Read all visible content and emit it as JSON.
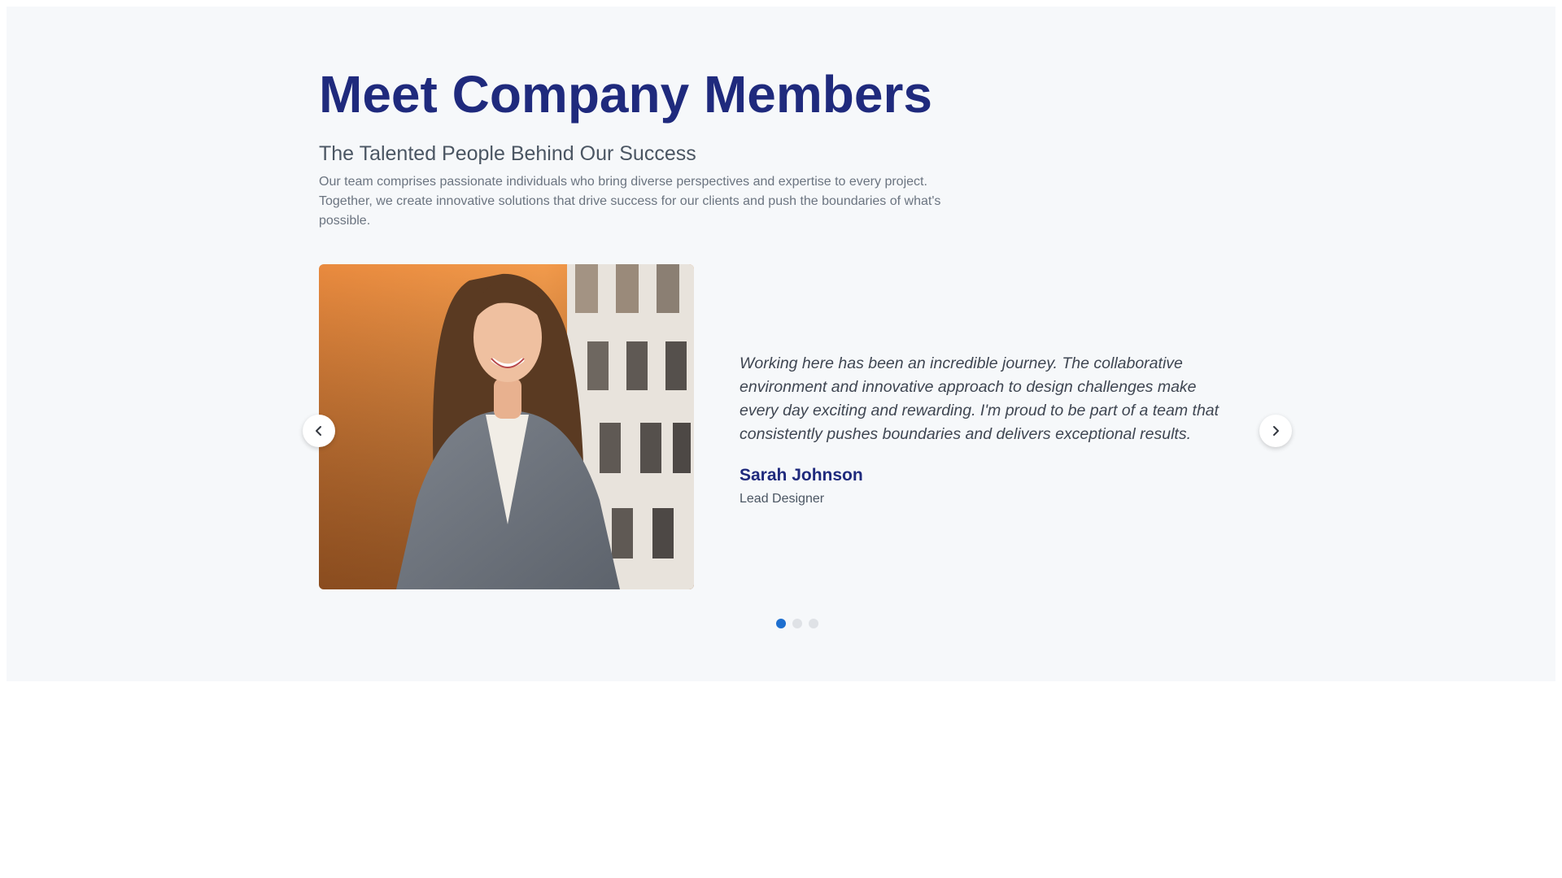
{
  "section": {
    "title": "Meet Company Members",
    "subtitle": "The Talented People Behind Our Success",
    "intro": "Our team comprises passionate individuals who bring diverse perspectives and expertise to every project. Together, we create innovative solutions that drive success for our clients and push the boundaries of what's possible."
  },
  "carousel": {
    "slide": {
      "quote": "Working here has been an incredible journey. The collaborative environment and innovative approach to design challenges make every day exciting and rewarding. I'm proud to be part of a team that consistently pushes boundaries and delivers exceptional results.",
      "name": "Sarah Johnson",
      "role": "Lead Designer"
    },
    "prev_icon": "chevron-left-icon",
    "next_icon": "chevron-right-icon",
    "slide_count": 3,
    "active_index": 0
  },
  "colors": {
    "title": "#1f2a7d",
    "accent": "#1e6fcf",
    "section_background": "#f6f8fa"
  }
}
